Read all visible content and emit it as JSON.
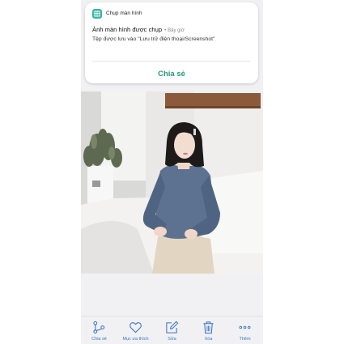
{
  "notification": {
    "app_name": "Chụp màn hình",
    "title": "Ảnh màn hình được chụp",
    "separator": "•",
    "time": "Bây giờ",
    "body": "Tệp được lưu vào \"Lưu trữ điện thoại/Screenshot\"",
    "action_label": "Chia sẻ",
    "icon": "screenshot-app-icon",
    "accent_color": "#1f9a7c"
  },
  "photo": {
    "description_icon": "photo-image"
  },
  "bottom_bar": {
    "accent_color": "#3a73c4",
    "items": [
      {
        "label": "Chia sẻ",
        "icon": "share-icon"
      },
      {
        "label": "Mục ưa thích",
        "icon": "heart-icon"
      },
      {
        "label": "Sửa",
        "icon": "edit-icon"
      },
      {
        "label": "Xóa",
        "icon": "trash-icon"
      },
      {
        "label": "Thêm",
        "icon": "more-icon"
      }
    ]
  }
}
